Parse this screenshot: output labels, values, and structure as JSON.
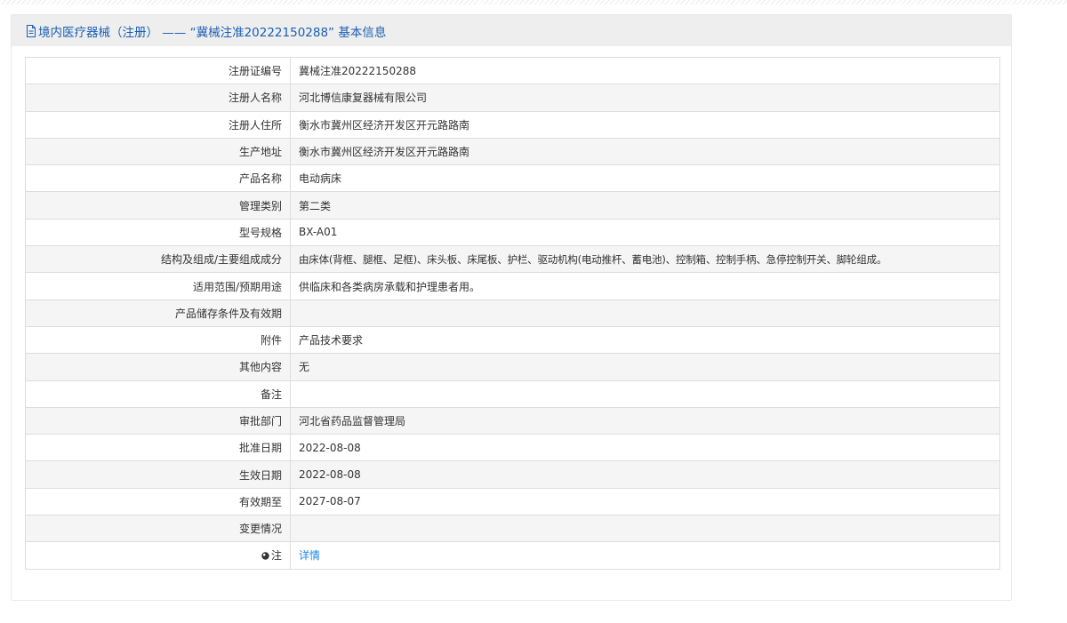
{
  "panel": {
    "title": "境内医疗器械（注册） —— “冀械注准20222150288” 基本信息",
    "title_icon": "document-icon"
  },
  "rows": [
    {
      "label": "注册证编号",
      "value": "冀械注准20222150288"
    },
    {
      "label": "注册人名称",
      "value": "河北博信康复器械有限公司"
    },
    {
      "label": "注册人住所",
      "value": "衡水市冀州区经济开发区开元路路南"
    },
    {
      "label": "生产地址",
      "value": "衡水市冀州区经济开发区开元路路南"
    },
    {
      "label": "产品名称",
      "value": "电动病床"
    },
    {
      "label": "管理类别",
      "value": "第二类"
    },
    {
      "label": "型号规格",
      "value": "BX-A01"
    },
    {
      "label": "结构及组成/主要组成成分",
      "value": "由床体(背框、腿框、足框)、床头板、床尾板、护栏、驱动机构(电动推杆、蓄电池)、控制箱、控制手柄、急停控制开关、脚轮组成。"
    },
    {
      "label": "适用范围/预期用途",
      "value": "供临床和各类病房承载和护理患者用。"
    },
    {
      "label": "产品储存条件及有效期",
      "value": ""
    },
    {
      "label": "附件",
      "value": "产品技术要求"
    },
    {
      "label": "其他内容",
      "value": "无"
    },
    {
      "label": "备注",
      "value": ""
    },
    {
      "label": "审批部门",
      "value": "河北省药品监督管理局"
    },
    {
      "label": "批准日期",
      "value": "2022-08-08"
    },
    {
      "label": "生效日期",
      "value": "2022-08-08"
    },
    {
      "label": "有效期至",
      "value": "2027-08-07"
    },
    {
      "label": "变更情况",
      "value": ""
    }
  ],
  "note_row": {
    "label": "注",
    "label_icon": "location-pin-icon",
    "link_text": "详情"
  },
  "colors": {
    "title": "#1a5fb4",
    "link": "#1e88e5",
    "header_bg": "#eeeeee",
    "row_alt_bg": "#f5f5f5",
    "border": "#dddddd"
  }
}
